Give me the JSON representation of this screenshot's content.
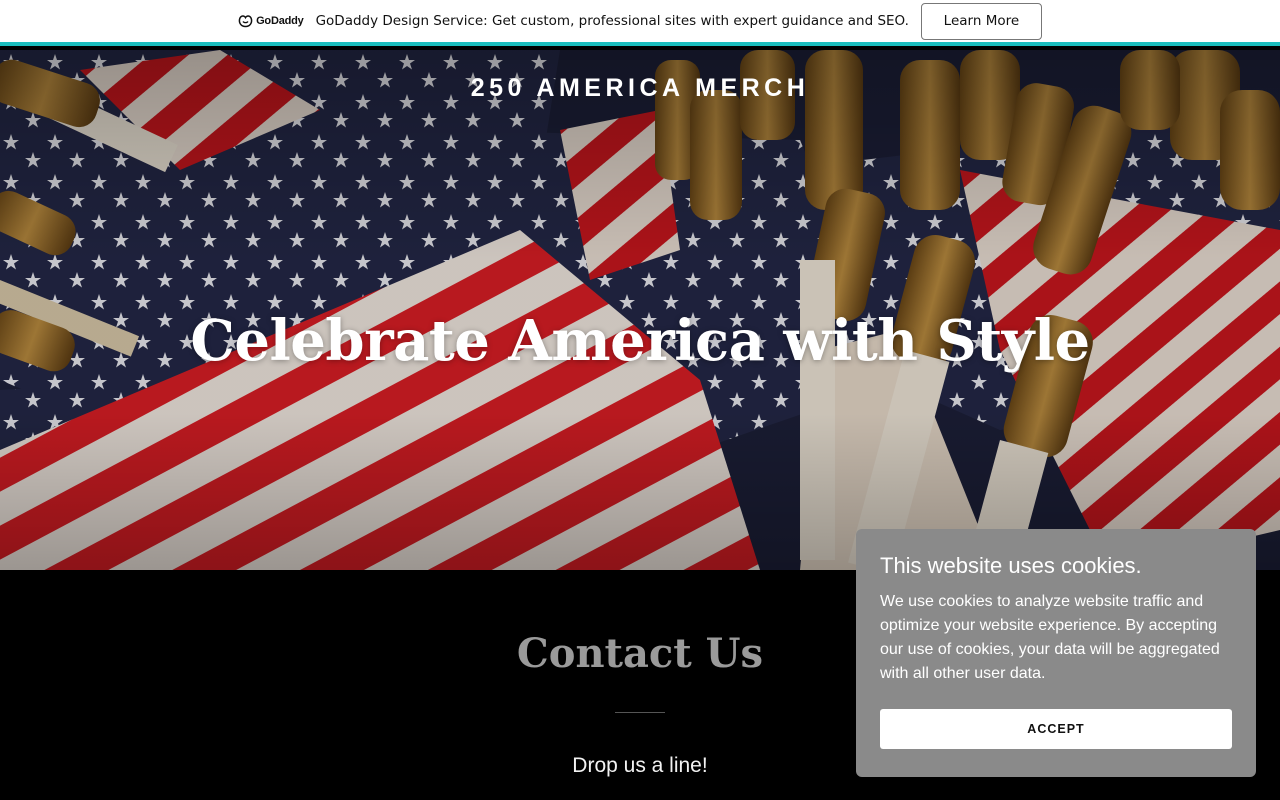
{
  "promo_bar": {
    "logo_text": "GoDaddy",
    "message": "GoDaddy Design Service: Get custom, professional sites with expert guidance and SEO.",
    "cta_label": "Learn More",
    "accent_color": "#1bbdbd"
  },
  "hero": {
    "site_title": "250 AMERICA MERCH",
    "heading": "Celebrate America with Style",
    "background_image": "american-flags-photo"
  },
  "contact": {
    "title": "Contact Us",
    "subtitle": "Drop us a line!"
  },
  "cookie_banner": {
    "title": "This website uses cookies.",
    "body": "We use cookies to analyze website traffic and optimize your website experience. By accepting our use of cookies, your data will be aggregated with all other user data.",
    "accept_label": "ACCEPT",
    "background_color": "#8a8a8a"
  }
}
